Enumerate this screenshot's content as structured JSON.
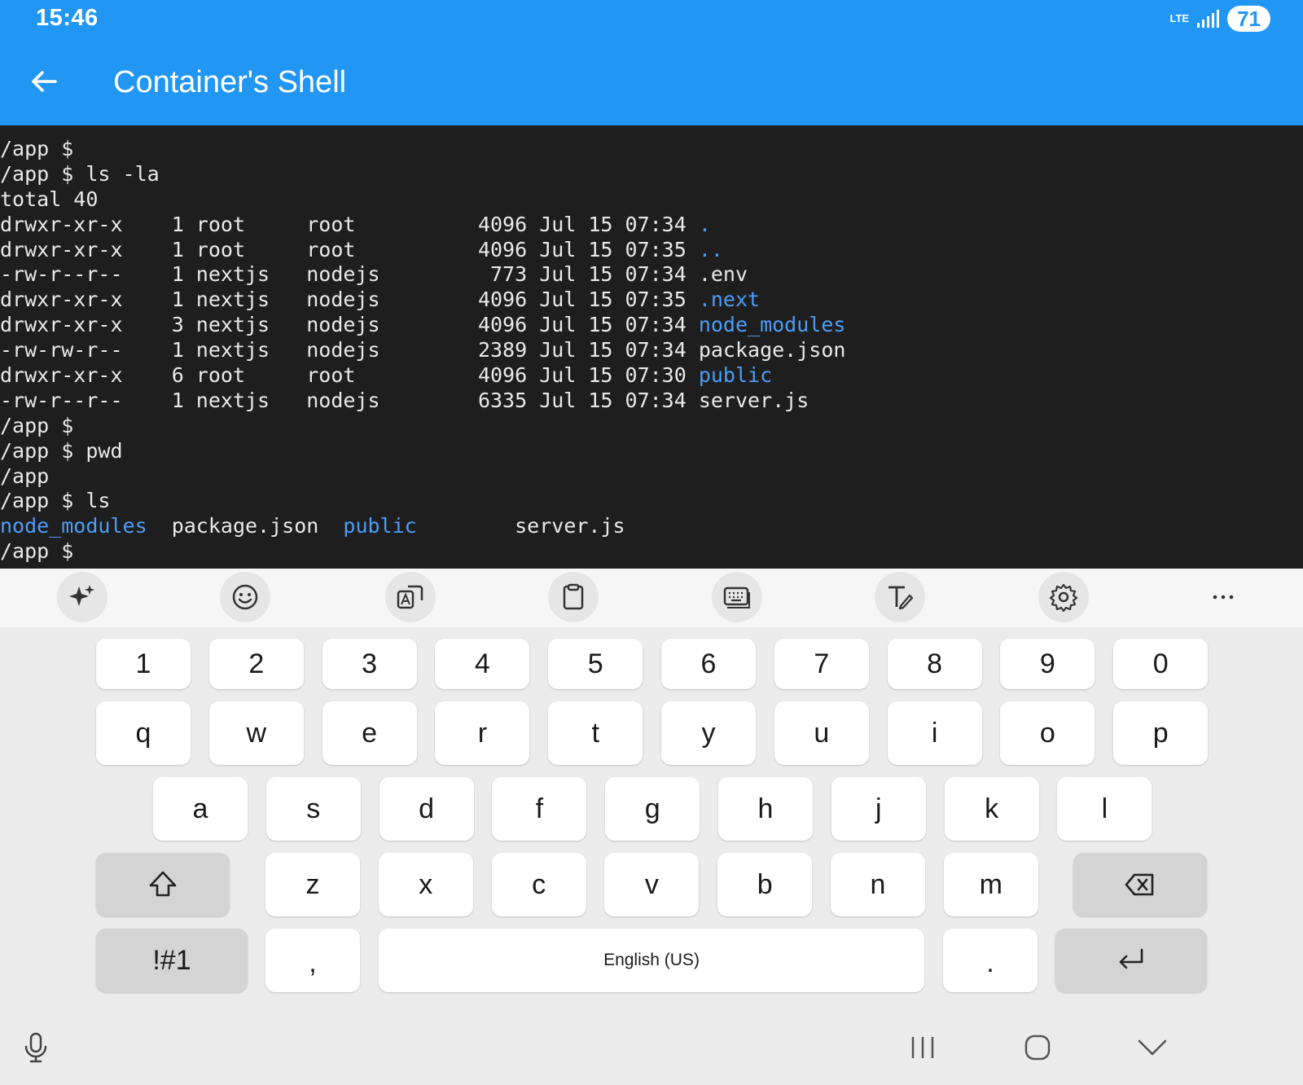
{
  "status_bar": {
    "time": "15:46",
    "network": "LTE",
    "battery": "71"
  },
  "app_bar": {
    "title": "Container's Shell",
    "back_icon": "arrow-left-icon"
  },
  "terminal": {
    "command_lines": [
      "/app $",
      "/app $ ls -la",
      "total 40"
    ],
    "listing": [
      {
        "perms": "drwxr-xr-x",
        "links": "1",
        "owner": "root",
        "group": "root",
        "size": "4096",
        "month": "Jul",
        "day": "15",
        "time": "07:34",
        "name": ".",
        "is_dir": true
      },
      {
        "perms": "drwxr-xr-x",
        "links": "1",
        "owner": "root",
        "group": "root",
        "size": "4096",
        "month": "Jul",
        "day": "15",
        "time": "07:35",
        "name": "..",
        "is_dir": true
      },
      {
        "perms": "-rw-r--r--",
        "links": "1",
        "owner": "nextjs",
        "group": "nodejs",
        "size": "773",
        "month": "Jul",
        "day": "15",
        "time": "07:34",
        "name": ".env",
        "is_dir": false
      },
      {
        "perms": "drwxr-xr-x",
        "links": "1",
        "owner": "nextjs",
        "group": "nodejs",
        "size": "4096",
        "month": "Jul",
        "day": "15",
        "time": "07:35",
        "name": ".next",
        "is_dir": true
      },
      {
        "perms": "drwxr-xr-x",
        "links": "3",
        "owner": "nextjs",
        "group": "nodejs",
        "size": "4096",
        "month": "Jul",
        "day": "15",
        "time": "07:34",
        "name": "node_modules",
        "is_dir": true
      },
      {
        "perms": "-rw-rw-r--",
        "links": "1",
        "owner": "nextjs",
        "group": "nodejs",
        "size": "2389",
        "month": "Jul",
        "day": "15",
        "time": "07:34",
        "name": "package.json",
        "is_dir": false
      },
      {
        "perms": "drwxr-xr-x",
        "links": "6",
        "owner": "root",
        "group": "root",
        "size": "4096",
        "month": "Jul",
        "day": "15",
        "time": "07:30",
        "name": "public",
        "is_dir": true
      },
      {
        "perms": "-rw-r--r--",
        "links": "1",
        "owner": "nextjs",
        "group": "nodejs",
        "size": "6335",
        "month": "Jul",
        "day": "15",
        "time": "07:34",
        "name": "server.js",
        "is_dir": false
      }
    ],
    "after_lines": [
      "/app $",
      "/app $ pwd",
      "/app",
      "/app $ ls"
    ],
    "ls_output": [
      {
        "name": "node_modules",
        "is_dir": true
      },
      {
        "name": "package.json",
        "is_dir": false
      },
      {
        "name": "public",
        "is_dir": true
      },
      {
        "name": "server.js",
        "is_dir": false
      }
    ],
    "prompt": "/app $",
    "dir_color": "#4c9df7",
    "text_color": "#e9e9e9",
    "background": "#1e1e1e"
  },
  "keyboard_toolbar": [
    {
      "name": "ai-sparkle-icon"
    },
    {
      "name": "emoji-icon"
    },
    {
      "name": "translate-icon"
    },
    {
      "name": "clipboard-icon"
    },
    {
      "name": "keyboard-mode-icon"
    },
    {
      "name": "handwriting-icon"
    },
    {
      "name": "settings-gear-icon"
    },
    {
      "name": "more-options-icon"
    }
  ],
  "keyboard": {
    "number_row": [
      "1",
      "2",
      "3",
      "4",
      "5",
      "6",
      "7",
      "8",
      "9",
      "0"
    ],
    "row1": [
      "q",
      "w",
      "e",
      "r",
      "t",
      "y",
      "u",
      "i",
      "o",
      "p"
    ],
    "row2": [
      "a",
      "s",
      "d",
      "f",
      "g",
      "h",
      "j",
      "k",
      "l"
    ],
    "row3": [
      "z",
      "x",
      "c",
      "v",
      "b",
      "n",
      "m"
    ],
    "symbols_label": "!#1",
    "comma": ",",
    "space_label": "English (US)",
    "period": ".",
    "shift_icon": "shift-icon",
    "backspace_icon": "backspace-icon",
    "enter_icon": "enter-icon"
  },
  "nav_bar": [
    "microphone-icon",
    "recents-icon",
    "home-icon",
    "hide-keyboard-icon"
  ],
  "colors": {
    "accent": "#2196f3",
    "keyboard_bg": "#ececec",
    "key_bg": "#ffffff",
    "func_key_bg": "#d4d4d4"
  }
}
